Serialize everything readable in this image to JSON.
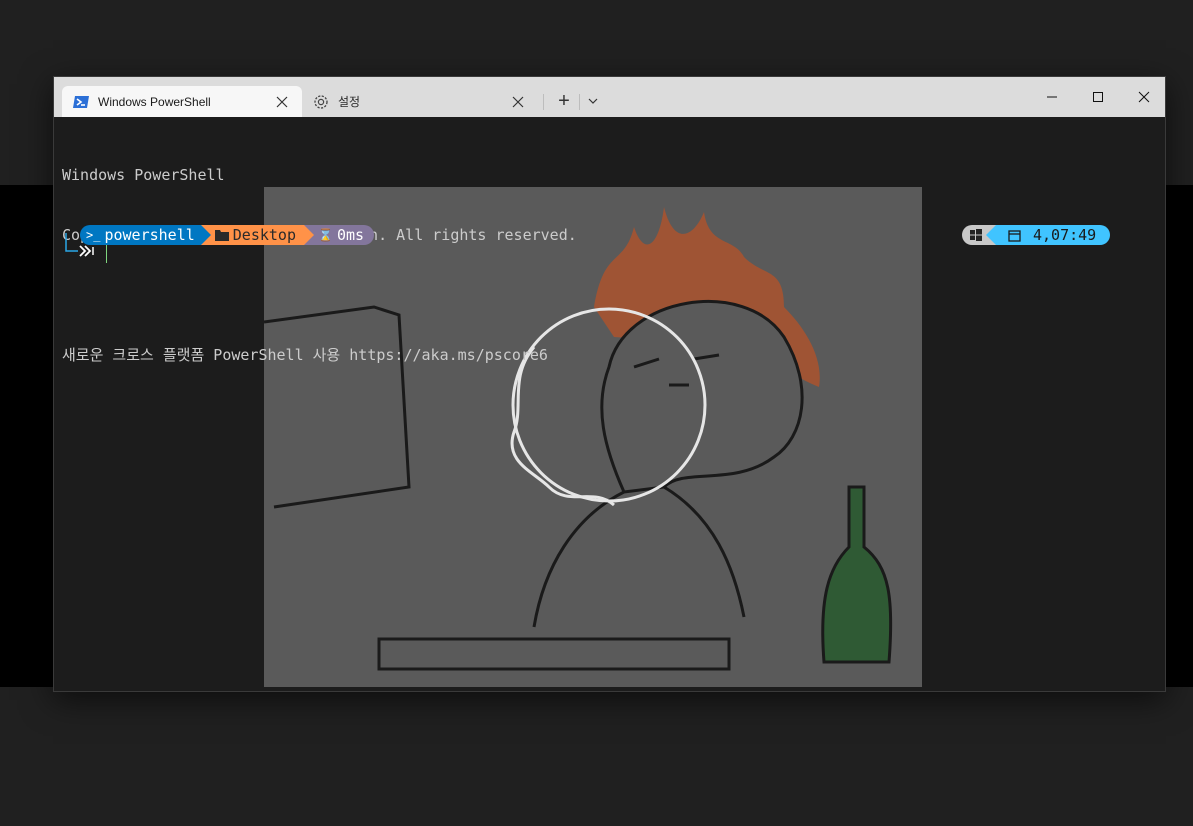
{
  "window": {
    "tabs": [
      {
        "label": "Windows PowerShell",
        "icon": "powershell-icon",
        "active": true
      },
      {
        "label": "설정",
        "icon": "gear-icon",
        "active": false
      }
    ],
    "new_tab_label": "+",
    "caption": {
      "minimize": "minimize-icon",
      "maximize": "maximize-icon",
      "close": "close-icon"
    }
  },
  "terminal": {
    "lines": [
      "Windows PowerShell",
      "Copyright (C) Microsoft Corporation. All rights reserved.",
      "",
      "새로운 크로스 플랫폼 PowerShell 사용 https://aka.ms/pscore6"
    ],
    "prompt": {
      "shell": "powershell",
      "path": "Desktop",
      "duration": "0ms",
      "clock": "4,07:49"
    },
    "colors": {
      "shell_segment": "#0077c2",
      "path_segment": "#ff9248",
      "duration_segment": "#83769c",
      "os_segment": "#c8c8c8",
      "clock_segment": "#40c4ff"
    }
  }
}
